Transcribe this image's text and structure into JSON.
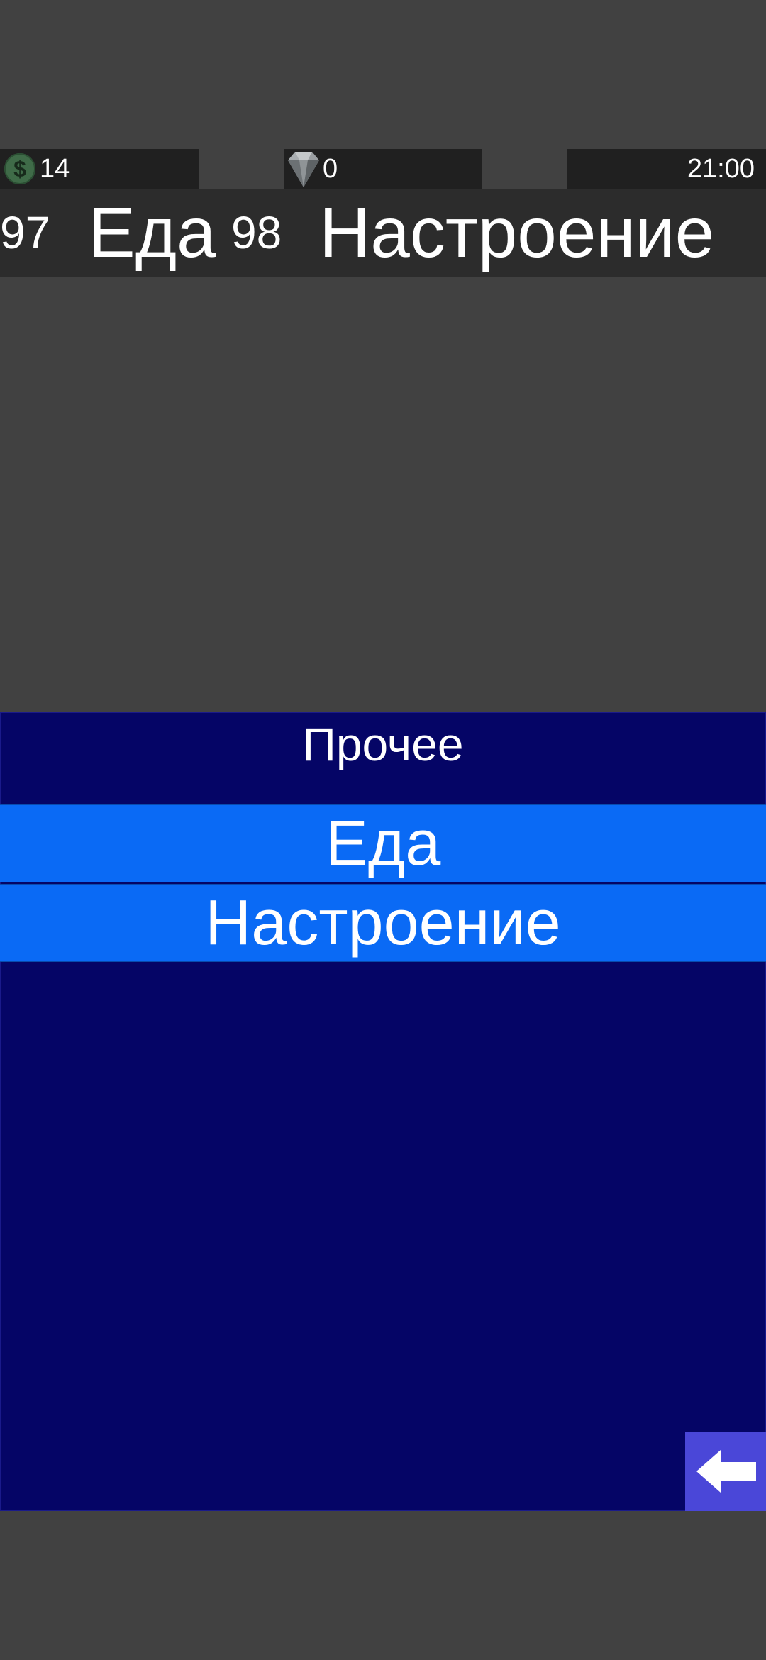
{
  "resources": {
    "money": "14",
    "gems": "0",
    "clock": "21:00"
  },
  "stats": {
    "food_value": "97",
    "food_label": "Еда",
    "mood_value": "98",
    "mood_label": "Настроение"
  },
  "panel": {
    "title": "Прочее",
    "items": [
      {
        "label": "Еда"
      },
      {
        "label": "Настроение"
      }
    ]
  },
  "icons": {
    "money": "dollar-coin-icon",
    "gems": "diamond-icon",
    "back": "arrow-left-icon"
  },
  "colors": {
    "background": "#414141",
    "panel": "#050566",
    "menu_item": "#0a6af5",
    "back_button": "#4a47d8"
  }
}
